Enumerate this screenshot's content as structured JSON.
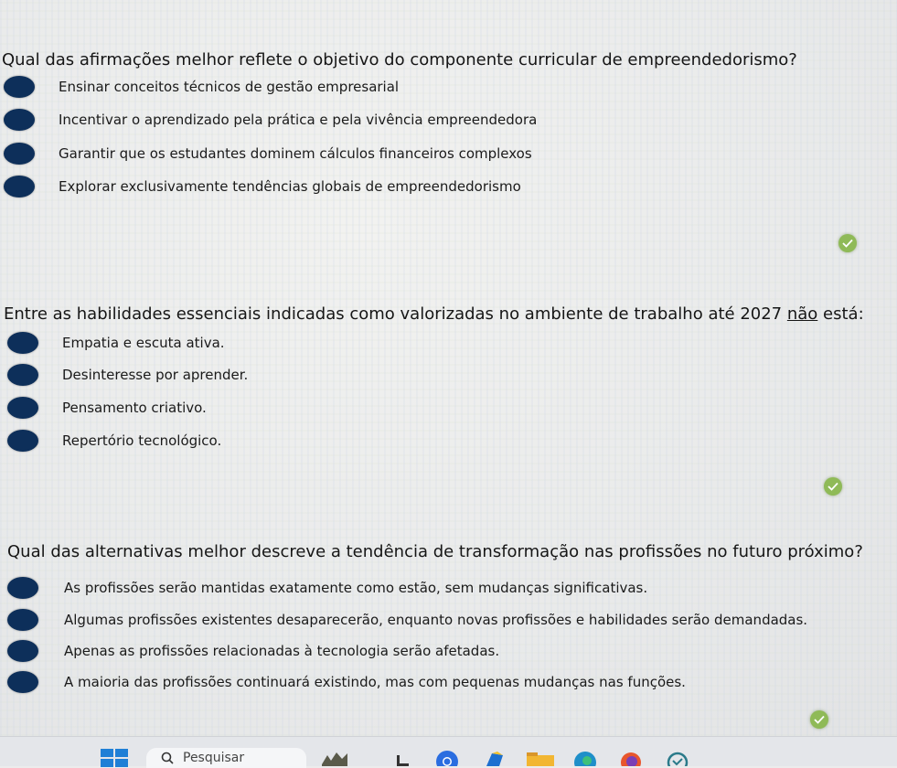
{
  "questions": [
    {
      "text": "Qual das afirmações melhor reflete o objetivo do componente curricular de empreendedorismo?",
      "options": [
        "Ensinar conceitos técnicos de gestão empresarial",
        "Incentivar o aprendizado pela prática e pela vivência empreendedora",
        "Garantir que os estudantes dominem cálculos financeiros complexos",
        "Explorar exclusivamente tendências globais de empreendedorismo"
      ]
    },
    {
      "text_before": "Entre as habilidades essenciais indicadas como valorizadas no ambiente de trabalho até 2027 ",
      "text_underlined": "não",
      "text_after": " está:",
      "options": [
        "Empatia e escuta ativa.",
        "Desinteresse por aprender.",
        "Pensamento criativo.",
        "Repertório tecnológico."
      ]
    },
    {
      "text": "Qual das alternativas melhor descreve a tendência de transformação nas profissões no futuro próximo?",
      "options": [
        "As profissões serão mantidas exatamente como estão, sem mudanças significativas.",
        "Algumas profissões existentes desaparecerão, enquanto novas profissões e habilidades serão demandadas.",
        "Apenas as profissões relacionadas à tecnologia serão afetadas.",
        "A maioria das profissões continuará existindo, mas com pequenas mudanças nas funções."
      ]
    }
  ],
  "taskbar": {
    "search_label": "Pesquisar"
  },
  "colors": {
    "bullet": "#0d2f5a",
    "check": "#8fba57",
    "windows_blue": "#1f7fd6"
  }
}
